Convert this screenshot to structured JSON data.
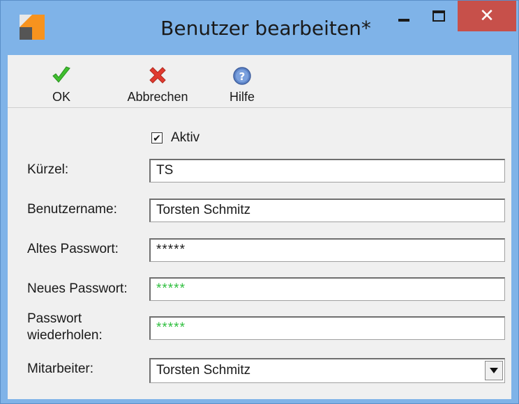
{
  "window": {
    "title": "Benutzer bearbeiten*",
    "close_glyph": "✕"
  },
  "toolbar": {
    "ok_label": "OK",
    "cancel_label": "Abbrechen",
    "help_label": "Hilfe"
  },
  "form": {
    "active": {
      "label": "Aktiv",
      "checked": true
    },
    "kuerzel": {
      "label": "Kürzel:",
      "value": "TS"
    },
    "benutzername": {
      "label": "Benutzername:",
      "value": "Torsten Schmitz"
    },
    "altes_passwort": {
      "label": "Altes Passwort:",
      "value": "*****"
    },
    "neues_passwort": {
      "label": "Neues Passwort:",
      "value": "*****"
    },
    "passwort_wiederholen": {
      "label_line1": "Passwort",
      "label_line2": "wiederholen:",
      "value": "*****"
    },
    "mitarbeiter": {
      "label": "Mitarbeiter:",
      "value": "Torsten Schmitz"
    }
  },
  "colors": {
    "titlebar": "#7fb3e8",
    "close_button": "#c7504a",
    "password_accent": "#2fbf3f"
  },
  "icons": {
    "app": "app-icon",
    "ok": "checkmark-icon",
    "cancel": "red-x-icon",
    "help": "question-icon",
    "dropdown": "triangle-down-icon"
  }
}
